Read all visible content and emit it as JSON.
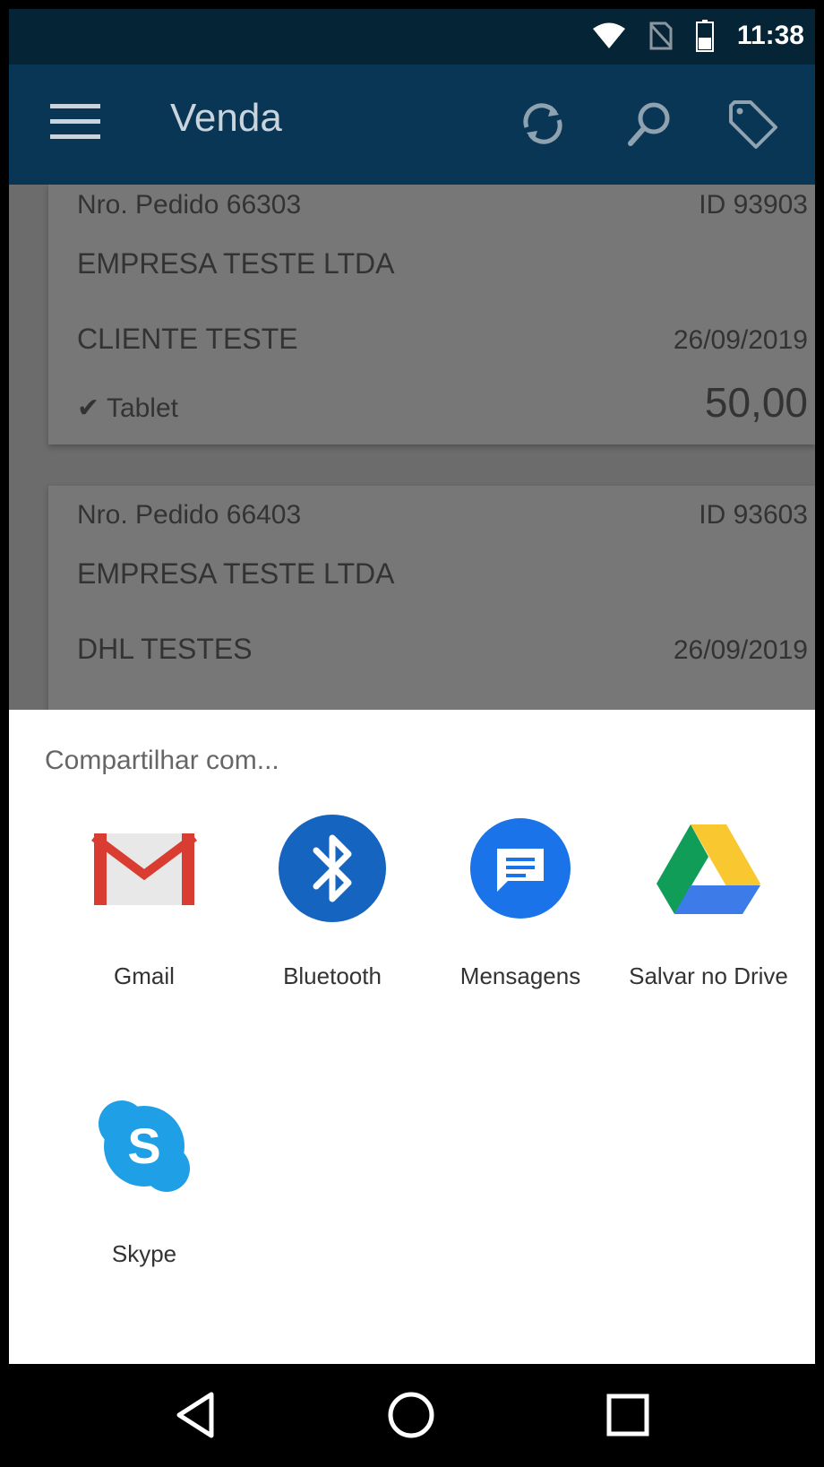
{
  "status_bar": {
    "time": "11:38",
    "icons": [
      "wifi-icon",
      "no-sim-icon",
      "battery-icon"
    ]
  },
  "app_bar": {
    "title": "Venda",
    "actions": [
      "sync-icon",
      "search-icon",
      "tag-icon"
    ]
  },
  "orders": [
    {
      "order_no": "Nro. Pedido 66303",
      "id": "ID 93903",
      "company": "EMPRESA TESTE LTDA",
      "client": "CLIENTE TESTE",
      "date": "26/09/2019",
      "origin": "Tablet",
      "total": "50,00"
    },
    {
      "order_no": "Nro. Pedido 66403",
      "id": "ID 93603",
      "company": "EMPRESA TESTE LTDA",
      "client": "DHL TESTES",
      "date": "26/09/2019"
    }
  ],
  "share_sheet": {
    "title": "Compartilhar com...",
    "apps": [
      {
        "label": "Gmail",
        "icon": "gmail-icon"
      },
      {
        "label": "Bluetooth",
        "icon": "bluetooth-icon"
      },
      {
        "label": "Mensagens",
        "icon": "messages-icon"
      },
      {
        "label": "Salvar no Drive",
        "icon": "drive-icon"
      },
      {
        "label": "Skype",
        "icon": "skype-icon"
      }
    ]
  },
  "colors": {
    "status_bar": "#052436",
    "app_bar": "#0a3656",
    "scrim": "#6c6c6c",
    "sheet": "#ffffff",
    "bluetooth_blue": "#1565c0"
  },
  "nav_bar": {
    "buttons": [
      "back-icon",
      "home-icon",
      "recents-icon"
    ]
  }
}
